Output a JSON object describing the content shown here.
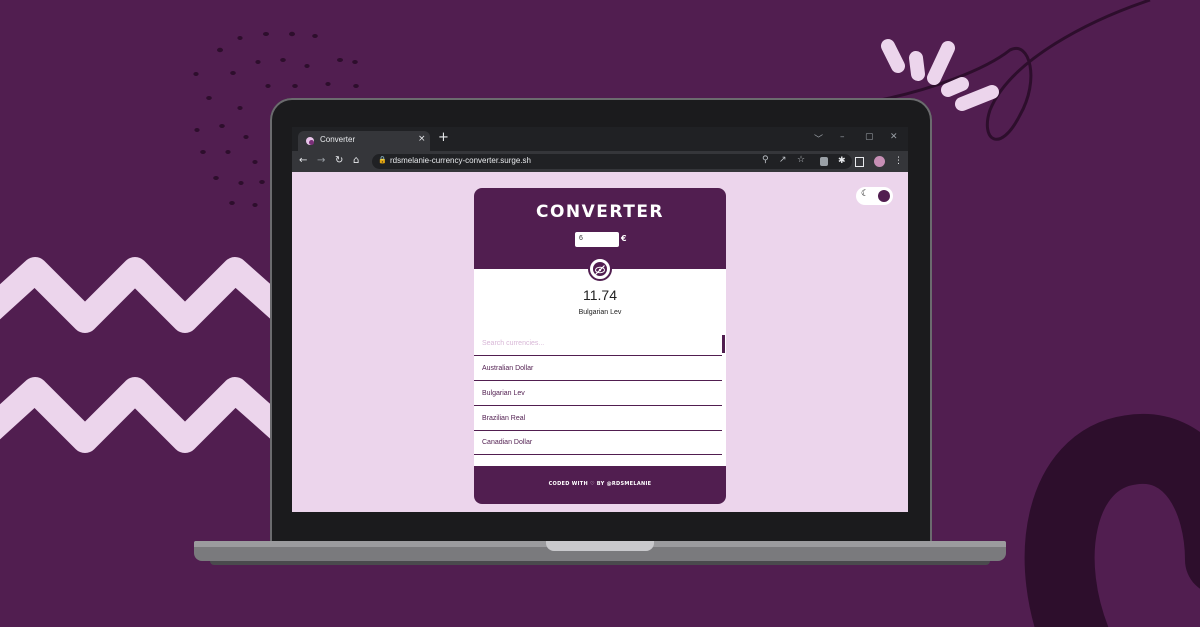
{
  "browser": {
    "tab_title": "Converter",
    "tab_close": "×",
    "new_tab": "+",
    "window_controls": [
      "﹀",
      "–",
      "▢",
      "✕"
    ],
    "url": "rdsmelanie-currency-converter.surge.sh",
    "nav": {
      "back": "←",
      "forward": "→",
      "reload": "↻",
      "home": "⌂"
    },
    "omnibox_icons": [
      "zoom-icon",
      "share-icon",
      "star-icon"
    ],
    "toolbar_icons": [
      "extension-badge-icon",
      "puzzle-icon",
      "sidepanel-icon",
      "profile-avatar",
      "kebab-menu-icon"
    ]
  },
  "converter": {
    "title": "CONVERTER",
    "amount_value": "6",
    "currency_symbol": "€",
    "result_value": "11.74",
    "result_currency": "Bulgarian Lev",
    "search_placeholder": "Search currencies...",
    "currencies": [
      "Australian Dollar",
      "Bulgarian Lev",
      "Brazilian Real",
      "Canadian Dollar"
    ],
    "footer": "CODED WITH ♡ BY @RDSMELANIE"
  },
  "theme_toggle": {
    "moon": "☾"
  },
  "colors": {
    "background": "#511e50",
    "page": "#ecd5ec",
    "accent": "#511e50",
    "light_stroke": "#ecd5ec"
  }
}
